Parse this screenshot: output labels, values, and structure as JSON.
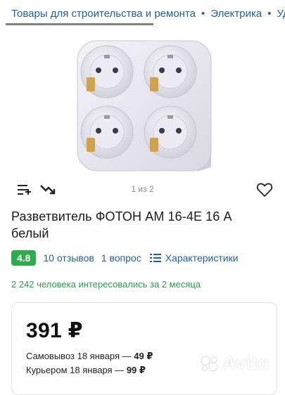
{
  "breadcrumb": {
    "items": [
      "Товары для строительства и ремонта",
      "Электрика",
      "Уд"
    ],
    "separator": "•"
  },
  "gallery": {
    "counter": "1 из 2",
    "add_to_compare_icon": "list-plus-icon",
    "price_trend_icon": "trend-down-icon",
    "favorite_icon": "heart-icon"
  },
  "product": {
    "title": "Разветвитель ФОТОН АМ 16-4Е 16 А белый"
  },
  "meta": {
    "rating": "4.8",
    "reviews": "10 отзывов",
    "questions": "1 вопрос",
    "specs": "Характеристики"
  },
  "interest": "2 242 человека интересовались за 2 месяца",
  "offer": {
    "price": "391 ₽",
    "pickup_label": "Самовывоз 18 января —",
    "pickup_price": "49 ₽",
    "courier_label": "Курьером 18 января —",
    "courier_price": "99 ₽"
  },
  "watermark": "Avito",
  "colors": {
    "link": "#1f5fa8",
    "rating_bg": "#2eab4c",
    "interest": "#2a9d4a"
  }
}
